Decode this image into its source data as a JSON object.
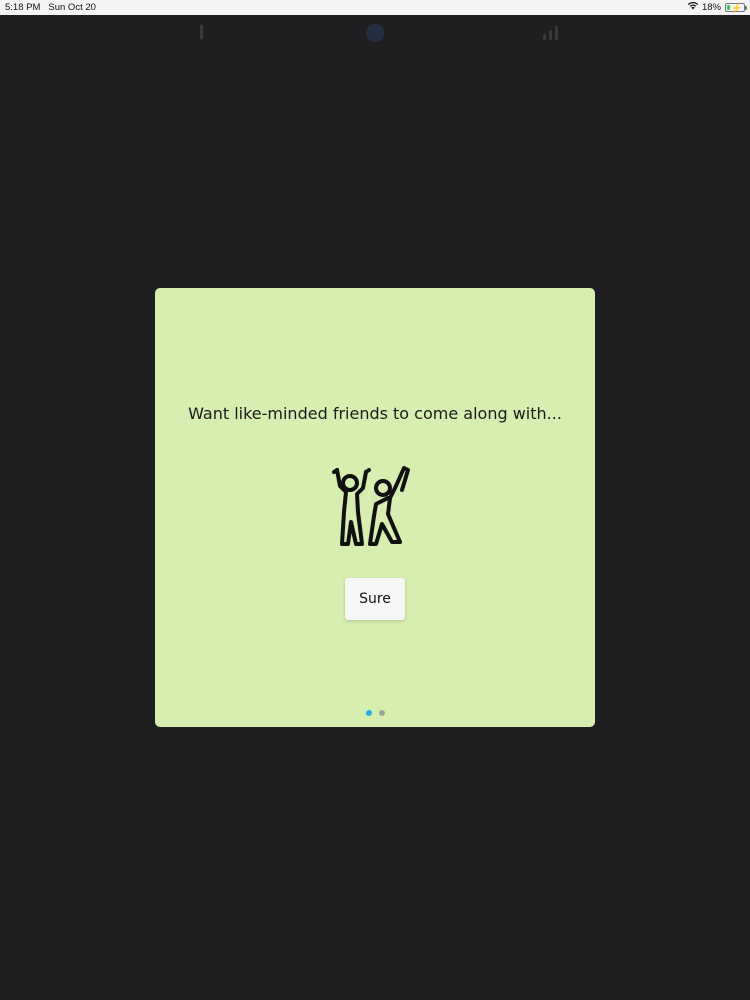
{
  "status_bar": {
    "time": "5:18 PM",
    "date": "Sun Oct 20",
    "battery": "18%",
    "battery_level": 0.18
  },
  "background_nav": {
    "icons": [
      "menu-icon",
      "logo-icon",
      "chart-icon"
    ]
  },
  "modal": {
    "prompt": "Want like-minded friends to come along with...",
    "illustration": "dancing-friends-icon",
    "button_label": "Sure",
    "pager": {
      "total": 2,
      "active": 0
    }
  },
  "colors": {
    "background": "#1f1e20",
    "modal_bg": "#d6eeb0",
    "active_dot": "#2ea8e0",
    "inactive_dot": "#98a890"
  }
}
